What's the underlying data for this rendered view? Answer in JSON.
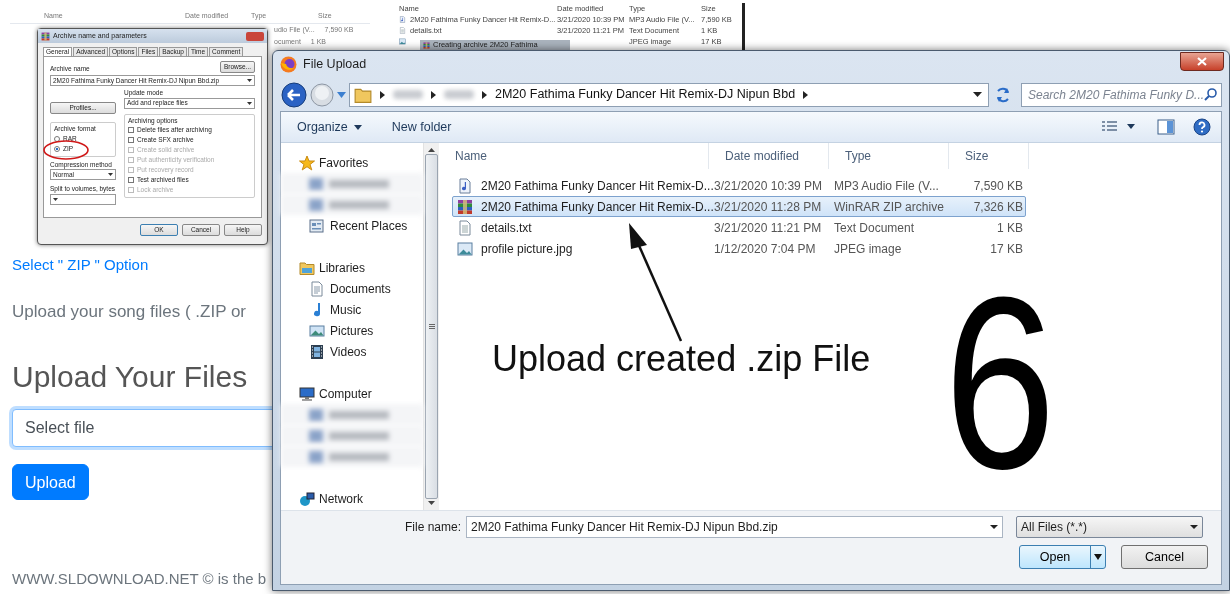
{
  "archive_screenshot": {
    "columns": [
      "Name",
      "Date modified",
      "Type",
      "Size"
    ],
    "rows": [
      {
        "type": "udio File (V...",
        "size": "7,590 KB"
      },
      {
        "type": "ocument",
        "size": "1 KB"
      }
    ],
    "dialog": {
      "title": "Archive name and parameters",
      "tabs": [
        {
          "label": "General",
          "selected": true
        },
        {
          "label": "Advanced",
          "selected": false
        },
        {
          "label": "Options",
          "selected": false
        },
        {
          "label": "Files",
          "selected": false
        },
        {
          "label": "Backup",
          "selected": false
        },
        {
          "label": "Time",
          "selected": false
        },
        {
          "label": "Comment",
          "selected": false
        }
      ],
      "archive_name_label": "Archive name",
      "browse_button": "Browse...",
      "archive_name": "2M20 Fathima Funky Dancer Hit Remix-DJ Nipun Bbd.zip",
      "profiles_button": "Profiles...",
      "update_mode_label": "Update mode",
      "update_mode": "Add and replace files",
      "format_label": "Archive format",
      "formats": [
        {
          "label": "RAR",
          "selected": false
        },
        {
          "label": "ZIP",
          "selected": true
        }
      ],
      "compression_label": "Compression method",
      "compression": "Normal",
      "split_label": "Split to volumes, bytes",
      "options_label": "Archiving options",
      "options": [
        {
          "label": "Delete files after archiving",
          "checked": false,
          "disabled": false
        },
        {
          "label": "Create SFX archive",
          "checked": false,
          "disabled": false
        },
        {
          "label": "Create solid archive",
          "checked": false,
          "disabled": true
        },
        {
          "label": "Put authenticity verification",
          "checked": false,
          "disabled": true
        },
        {
          "label": "Put recovery record",
          "checked": false,
          "disabled": true
        },
        {
          "label": "Test archived files",
          "checked": false,
          "disabled": false
        },
        {
          "label": "Lock archive",
          "checked": false,
          "disabled": true
        }
      ],
      "buttons": [
        "OK",
        "Cancel",
        "Help"
      ]
    }
  },
  "explorer_screenshot": {
    "columns": [
      "Name",
      "Date modified",
      "Type",
      "Size"
    ],
    "rows": [
      {
        "kind": "audio",
        "name": "2M20 Fathima Funky Dancer Hit Remix-D...",
        "date": "3/21/2020 10:39 PM",
        "type": "MP3 Audio File (V...",
        "size": "7,590 KB"
      },
      {
        "kind": "text",
        "name": "details.txt",
        "date": "3/21/2020 11:21 PM",
        "type": "Text Document",
        "size": "1 KB"
      },
      {
        "kind": "image",
        "type": "JPEG image",
        "size": "17 KB"
      }
    ],
    "progress_title": "Creating archive 2M20 Fathima"
  },
  "page": {
    "link": "Select \" ZIP \" Option",
    "paragraph": "Upload your song files ( .ZIP or",
    "heading": "Upload Your Files",
    "file_input": {
      "placeholder": "Select file"
    },
    "upload_button": "Upload",
    "footer": "WWW.SLDOWNLOAD.NET © is the b"
  },
  "file_dialog": {
    "title": "File Upload",
    "path": [
      {
        "kind": "blurred"
      },
      {
        "kind": "blurred"
      },
      {
        "kind": "folder",
        "label": "2M20 Fathima Funky Dancer Hit Remix-DJ Nipun Bbd"
      }
    ],
    "search": {
      "placeholder": "Search 2M20 Fathima Funky D..."
    },
    "toolbar": [
      {
        "kind": "menu",
        "label": "Organize"
      },
      {
        "kind": "button",
        "label": "New folder"
      }
    ],
    "nav": [
      {
        "kind": "star",
        "label": "Favorites",
        "children": [
          {
            "kind": "blurred"
          },
          {
            "kind": "blurred"
          },
          {
            "kind": "recent",
            "label": "Recent Places"
          }
        ]
      },
      {
        "kind": "library",
        "label": "Libraries",
        "children": [
          {
            "kind": "document",
            "label": "Documents"
          },
          {
            "kind": "music",
            "label": "Music"
          },
          {
            "kind": "pictures",
            "label": "Pictures"
          },
          {
            "kind": "videos",
            "label": "Videos"
          }
        ]
      },
      {
        "kind": "computer",
        "label": "Computer",
        "children": [
          {
            "kind": "blurred"
          },
          {
            "kind": "blurred"
          },
          {
            "kind": "blurred"
          }
        ]
      },
      {
        "kind": "network",
        "label": "Network"
      }
    ],
    "columns": [
      "Name",
      "Date modified",
      "Type",
      "Size"
    ],
    "rows": [
      {
        "kind": "audio",
        "name": "2M20 Fathima Funky Dancer Hit Remix-D...",
        "date": "3/21/2020 10:39 PM",
        "type": "MP3 Audio File (V...",
        "size": "7,590 KB",
        "selected": false
      },
      {
        "kind": "archive",
        "name": "2M20 Fathima Funky Dancer Hit Remix-D...",
        "date": "3/21/2020 11:28 PM",
        "type": "WinRAR ZIP archive",
        "size": "7,326 KB",
        "selected": true
      },
      {
        "kind": "text",
        "name": "details.txt",
        "date": "3/21/2020 11:21 PM",
        "type": "Text Document",
        "size": "1 KB",
        "selected": false
      },
      {
        "kind": "image",
        "name": "profile picture.jpg",
        "date": "1/12/2020 7:04 PM",
        "type": "JPEG image",
        "size": "17 KB",
        "selected": false
      }
    ],
    "file_name_label": "File name:",
    "file_name": "2M20 Fathima Funky Dancer Hit Remix-DJ Nipun Bbd.zip",
    "file_type": "All Files (*.*)",
    "open_button": "Open",
    "cancel_button": "Cancel"
  },
  "annotation": {
    "caption": "Upload created .zip File",
    "step": "6"
  }
}
